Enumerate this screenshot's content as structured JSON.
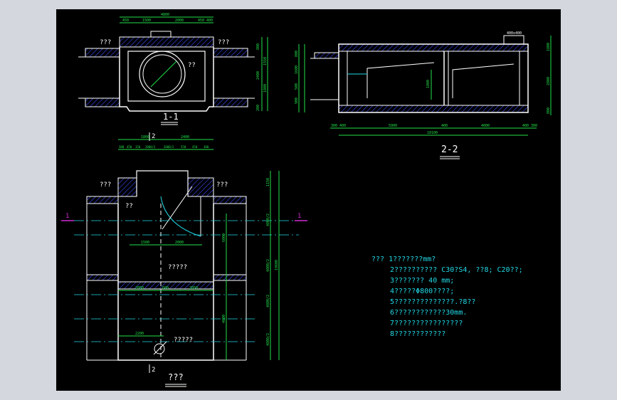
{
  "colors": {
    "background": "#000000",
    "wall": "#ffffff",
    "dimension": "#22e04a",
    "text": "#ffffff",
    "notes": "#22d8e6",
    "hatch": "#3a4cff",
    "cut_mark": "#d02bd0",
    "centerline": "#22d8e6"
  },
  "section_1_1": {
    "title": "1-1",
    "label_left": "???",
    "label_right": "???",
    "label_circle": "??",
    "top_dims": [
      "4800",
      "450",
      "1500",
      "2000",
      "450",
      "400"
    ],
    "right_dims": [
      "800",
      "2400",
      "1550",
      "1800",
      "200"
    ]
  },
  "section_2_2": {
    "title": "2-2",
    "top_label": "400x400",
    "bottom_dims": [
      "300",
      "400",
      "5900",
      "400",
      "4000",
      "400",
      "300"
    ],
    "bottom_total": "10100",
    "left_dims": [
      "800",
      "1600",
      "500",
      "900"
    ],
    "right_dims": [
      "1800",
      "2800",
      "800"
    ],
    "mid_dim": "1800"
  },
  "plan": {
    "title": "???",
    "cut_top": "2",
    "cut_bottom": "2",
    "cut_left": "1",
    "cut_right": "1",
    "label_wall_left": "???",
    "label_wall_right": "???",
    "label_small": "??",
    "label_mid": "?????",
    "label_bottom": "?????",
    "top_dims_row1": [
      "1800",
      "2400"
    ],
    "top_dims_row2": [
      "300",
      "450",
      "150",
      "2000/2",
      "2000/2",
      "550",
      "450",
      "300"
    ],
    "inner_dims_a": [
      "1500",
      "2000"
    ],
    "inner_dims_b": [
      "2050",
      "600",
      "2050"
    ],
    "inner_dims_c": "2200",
    "right_dims": [
      "1150",
      "4800/2",
      "4800/2",
      "4800/2",
      "4800/2"
    ],
    "right_total": "19600",
    "right_inner": [
      "6000",
      "4000"
    ]
  },
  "notes": {
    "lines": [
      "??? 1???????mm?",
      "2??????????  C30?S4,    ??8;    C20??;",
      "3???????  40 mm;",
      "4?????Φ800????;",
      "5??????????????.?8??",
      "6????????????30mm.",
      "7????????????????",
      "8????????????"
    ]
  }
}
